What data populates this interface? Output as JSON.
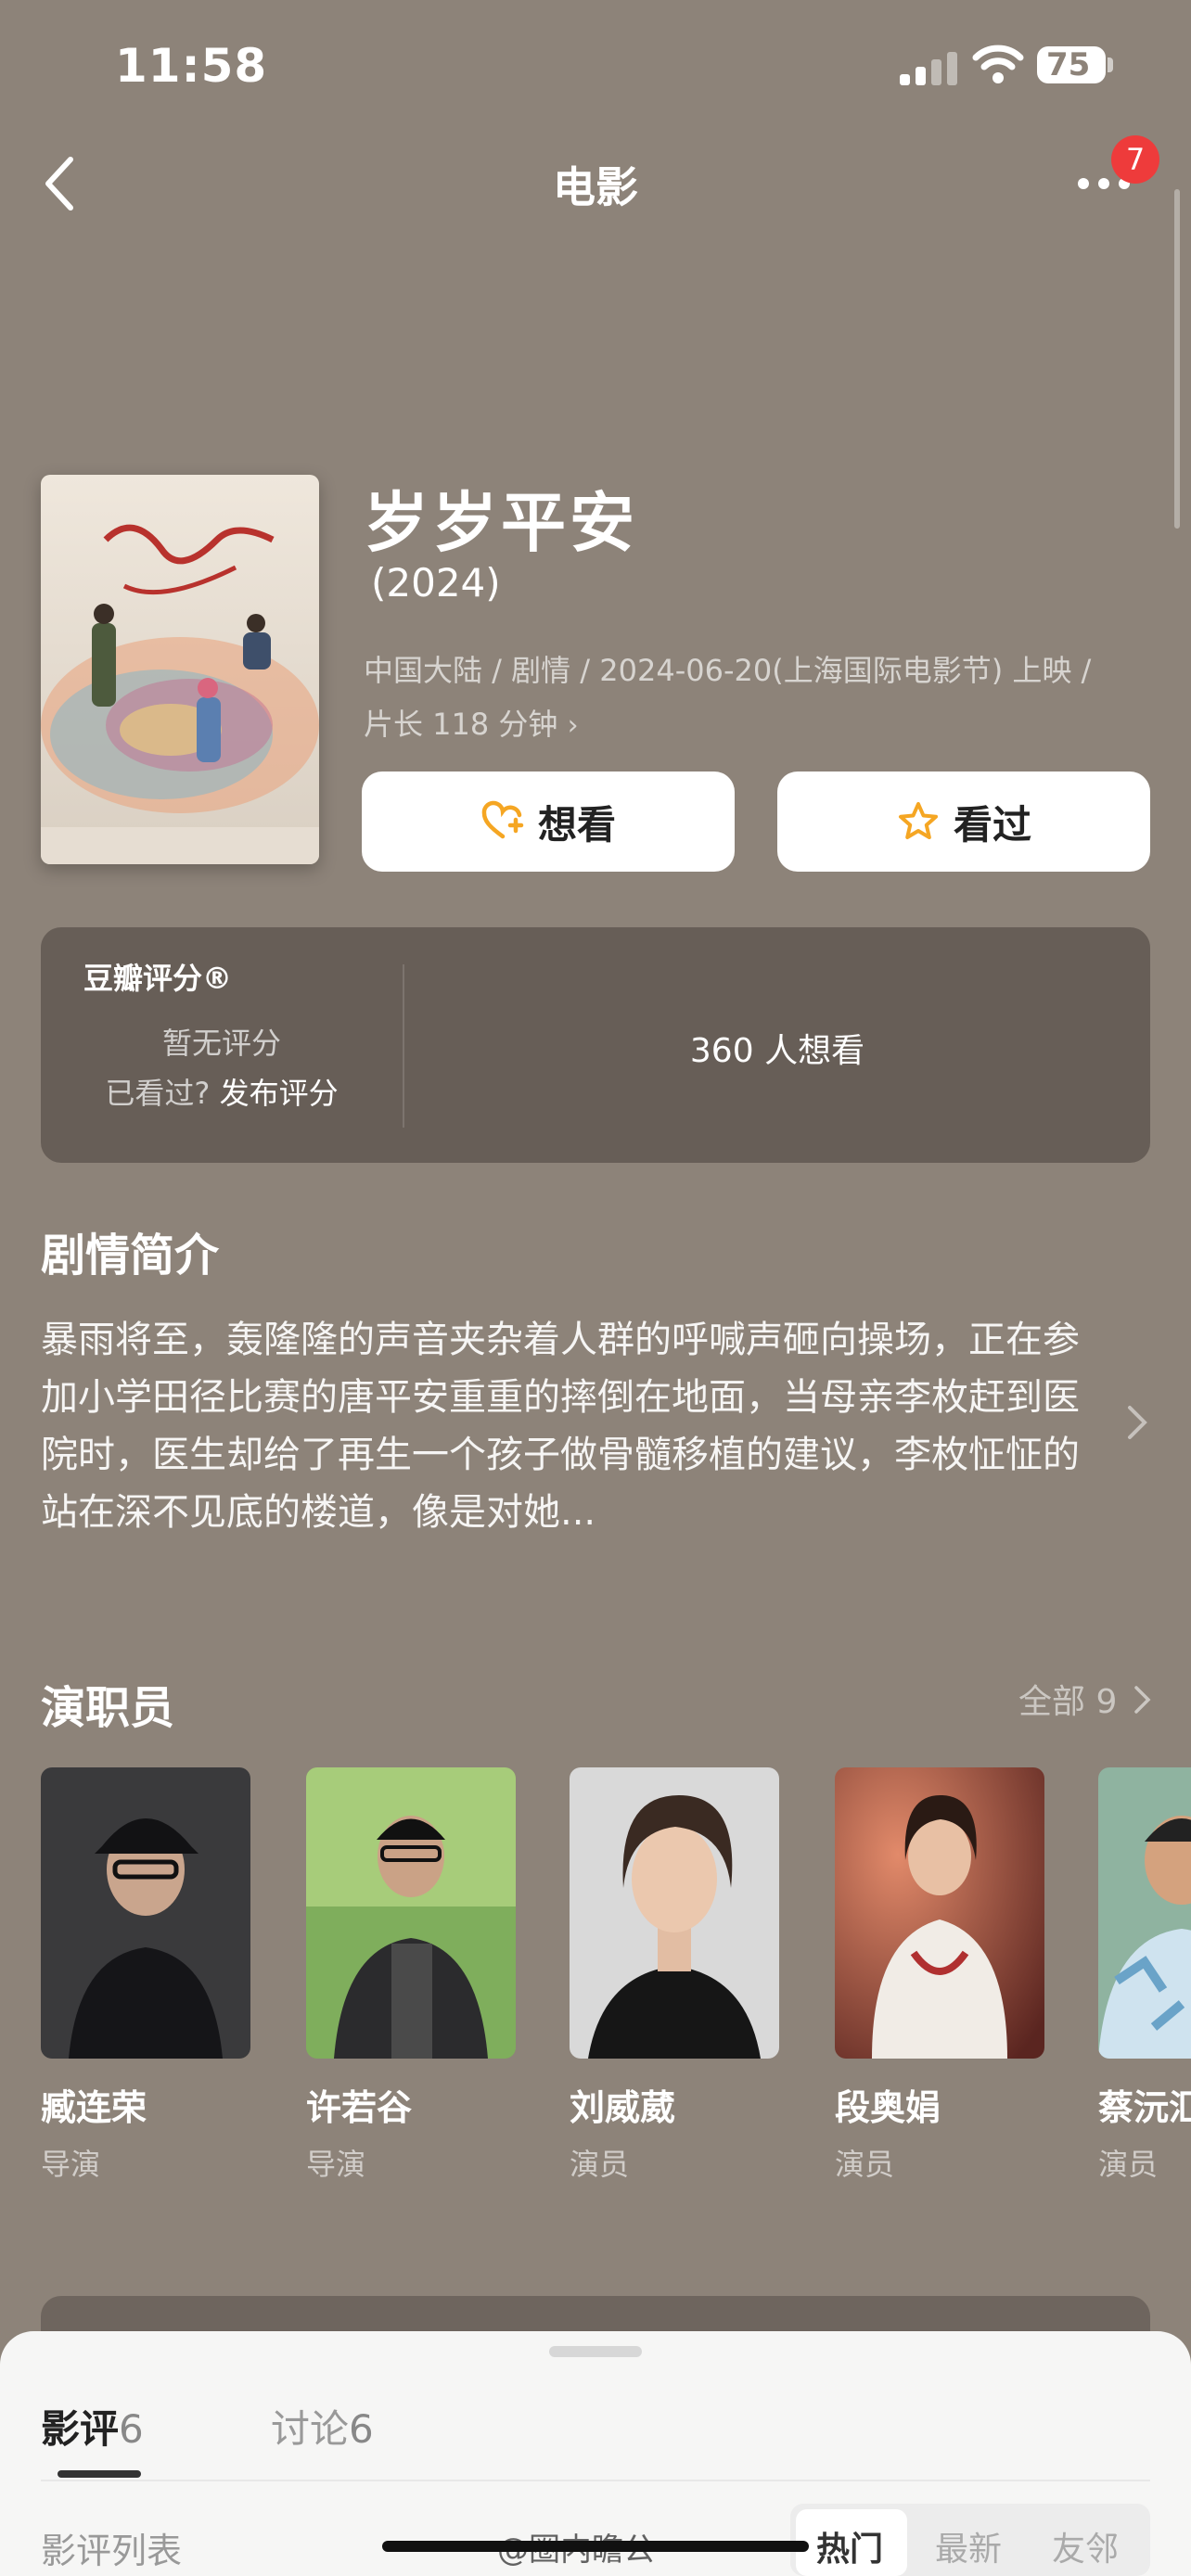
{
  "status": {
    "time": "11:58",
    "battery": "75"
  },
  "nav": {
    "title": "电影",
    "badge": "7"
  },
  "movie": {
    "title": "岁岁平安",
    "year": "(2024)",
    "meta": "中国大陆 / 剧情 / 2024-06-20(上海国际电影节) 上映 /",
    "duration": "片长 118 分钟"
  },
  "actions": {
    "want": "想看",
    "seen": "看过"
  },
  "rating": {
    "label": "豆瓣评分®",
    "none": "暂无评分",
    "seen_q": "已看过?",
    "publish": "发布评分",
    "want_count": "360 人想看"
  },
  "synopsis": {
    "heading": "剧情简介",
    "text": "暴雨将至，轰隆隆的声音夹杂着人群的呼喊声砸向操场，正在参加小学田径比赛的唐平安重重的摔倒在地面，当母亲李枚赶到医院时，医生却给了再生一个孩子做骨髓移植的建议，李枚怔怔的站在深不见底的楼道，像是对她..."
  },
  "cast": {
    "heading": "演职员",
    "all": "全部 9",
    "members": [
      {
        "name": "臧连荣",
        "role": "导演"
      },
      {
        "name": "许若谷",
        "role": "导演"
      },
      {
        "name": "刘威葳",
        "role": "演员"
      },
      {
        "name": "段奥娟",
        "role": "演员"
      },
      {
        "name": "蔡沅汇",
        "role": "演员"
      }
    ]
  },
  "sheet": {
    "tab_reviews": "影评",
    "tab_reviews_count": "6",
    "tab_discuss": "讨论",
    "tab_discuss_count": "6",
    "list_label": "影评列表",
    "sort_hot": "热门",
    "sort_new": "最新",
    "sort_friends": "友邻",
    "watermark": "@圈内瞻公"
  },
  "colors": {
    "background": "#8d8379",
    "badge": "#ee3b3b",
    "star": "#f5a623"
  }
}
